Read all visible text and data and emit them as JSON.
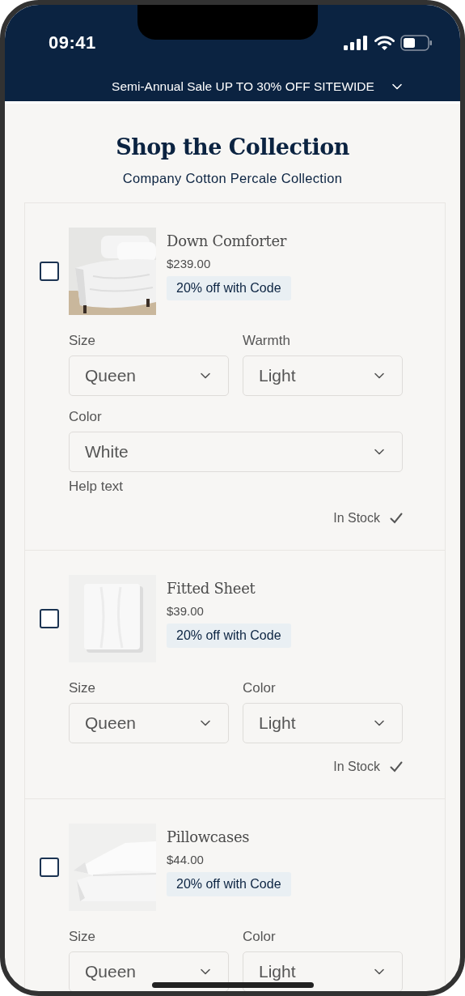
{
  "status_bar": {
    "time": "09:41"
  },
  "promo_banner": {
    "text": "Semi-Annual Sale UP TO 30% OFF SITEWIDE"
  },
  "heading": {
    "title": "Shop the Collection",
    "subtitle": "Company Cotton Percale Collection"
  },
  "products": [
    {
      "name": "Down Comforter",
      "price": "$239.00",
      "badge": "20% off with Code",
      "checked": false,
      "option_rows": [
        [
          {
            "label": "Size",
            "value": "Queen"
          },
          {
            "label": "Warmth",
            "value": "Light"
          }
        ],
        [
          {
            "label": "Color",
            "value": "White",
            "help": "Help text"
          }
        ]
      ],
      "stock": "In Stock"
    },
    {
      "name": "Fitted Sheet",
      "price": "$39.00",
      "badge": "20% off with Code",
      "checked": false,
      "option_rows": [
        [
          {
            "label": "Size",
            "value": "Queen"
          },
          {
            "label": "Color",
            "value": "Light"
          }
        ]
      ],
      "stock": "In Stock"
    },
    {
      "name": "Pillowcases",
      "price": "$44.00",
      "badge": "20% off with Code",
      "checked": false,
      "option_rows": [
        [
          {
            "label": "Size",
            "value": "Queen"
          },
          {
            "label": "Color",
            "value": "Light"
          }
        ]
      ]
    }
  ]
}
